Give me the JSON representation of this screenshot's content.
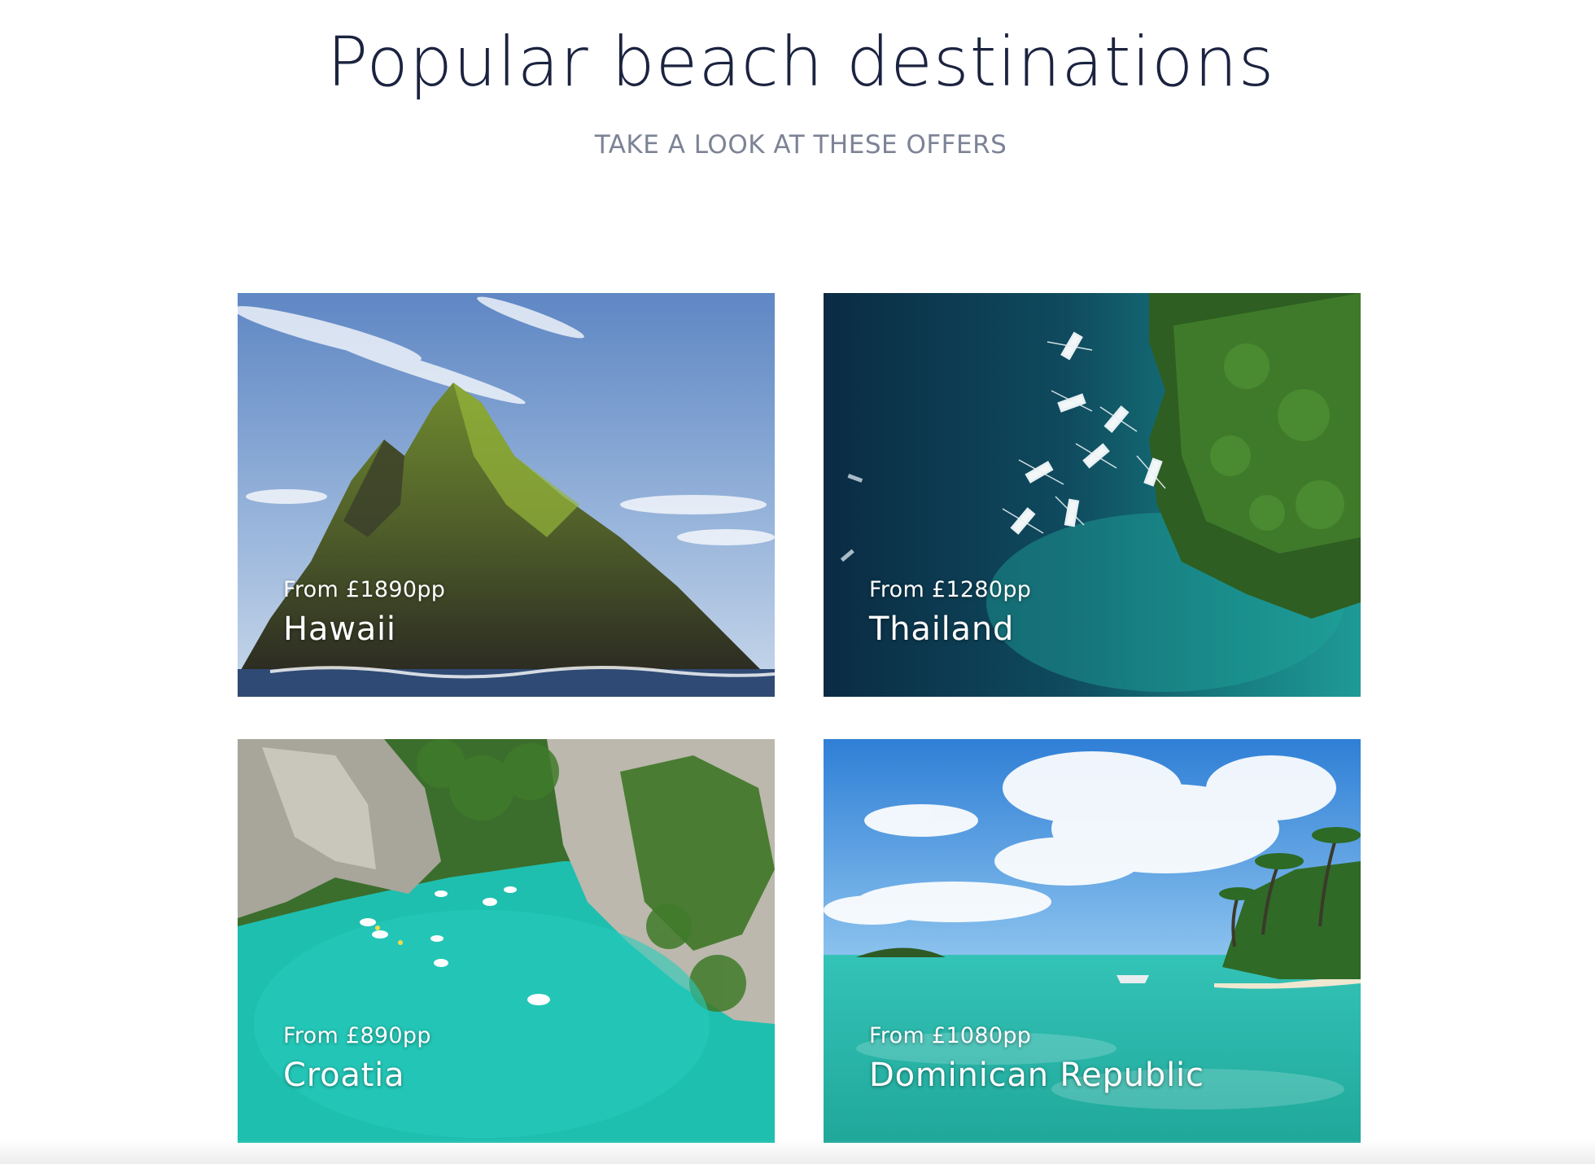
{
  "page": {
    "heading": "Popular beach destinations",
    "subheading": "TAKE A LOOK AT THESE OFFERS"
  },
  "destinations": [
    {
      "name": "Hawaii",
      "price": "From £1890pp",
      "image": "rocky-island-sea-photo"
    },
    {
      "name": "Thailand",
      "price": "From £1280pp",
      "image": "aerial-boats-reef-photo"
    },
    {
      "name": "Croatia",
      "price": "From £890pp",
      "image": "turquoise-river-canyon-photo"
    },
    {
      "name": "Dominican Republic",
      "price": "From £1080pp",
      "image": "tropical-lagoon-palms-photo"
    }
  ],
  "colors": {
    "heading": "#1b2340",
    "subheading": "#7d8396",
    "caption": "#ffffff"
  }
}
